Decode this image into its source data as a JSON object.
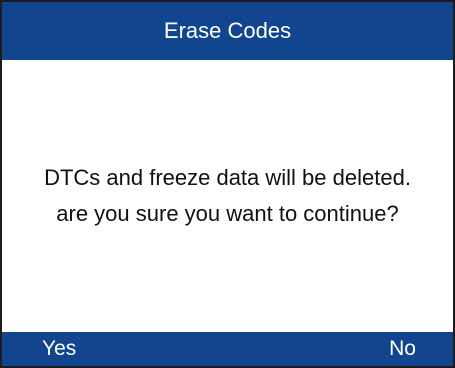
{
  "title": "Erase Codes",
  "message": {
    "line1": "DTCs and freeze data will be deleted.",
    "line2": "are you sure you want to continue?"
  },
  "softkeys": {
    "yes_label": "Yes",
    "no_label": "No"
  },
  "colors": {
    "bar_background": "#11458f",
    "bar_text": "#ffffff",
    "body_background": "#ffffff",
    "body_text": "#111111"
  }
}
